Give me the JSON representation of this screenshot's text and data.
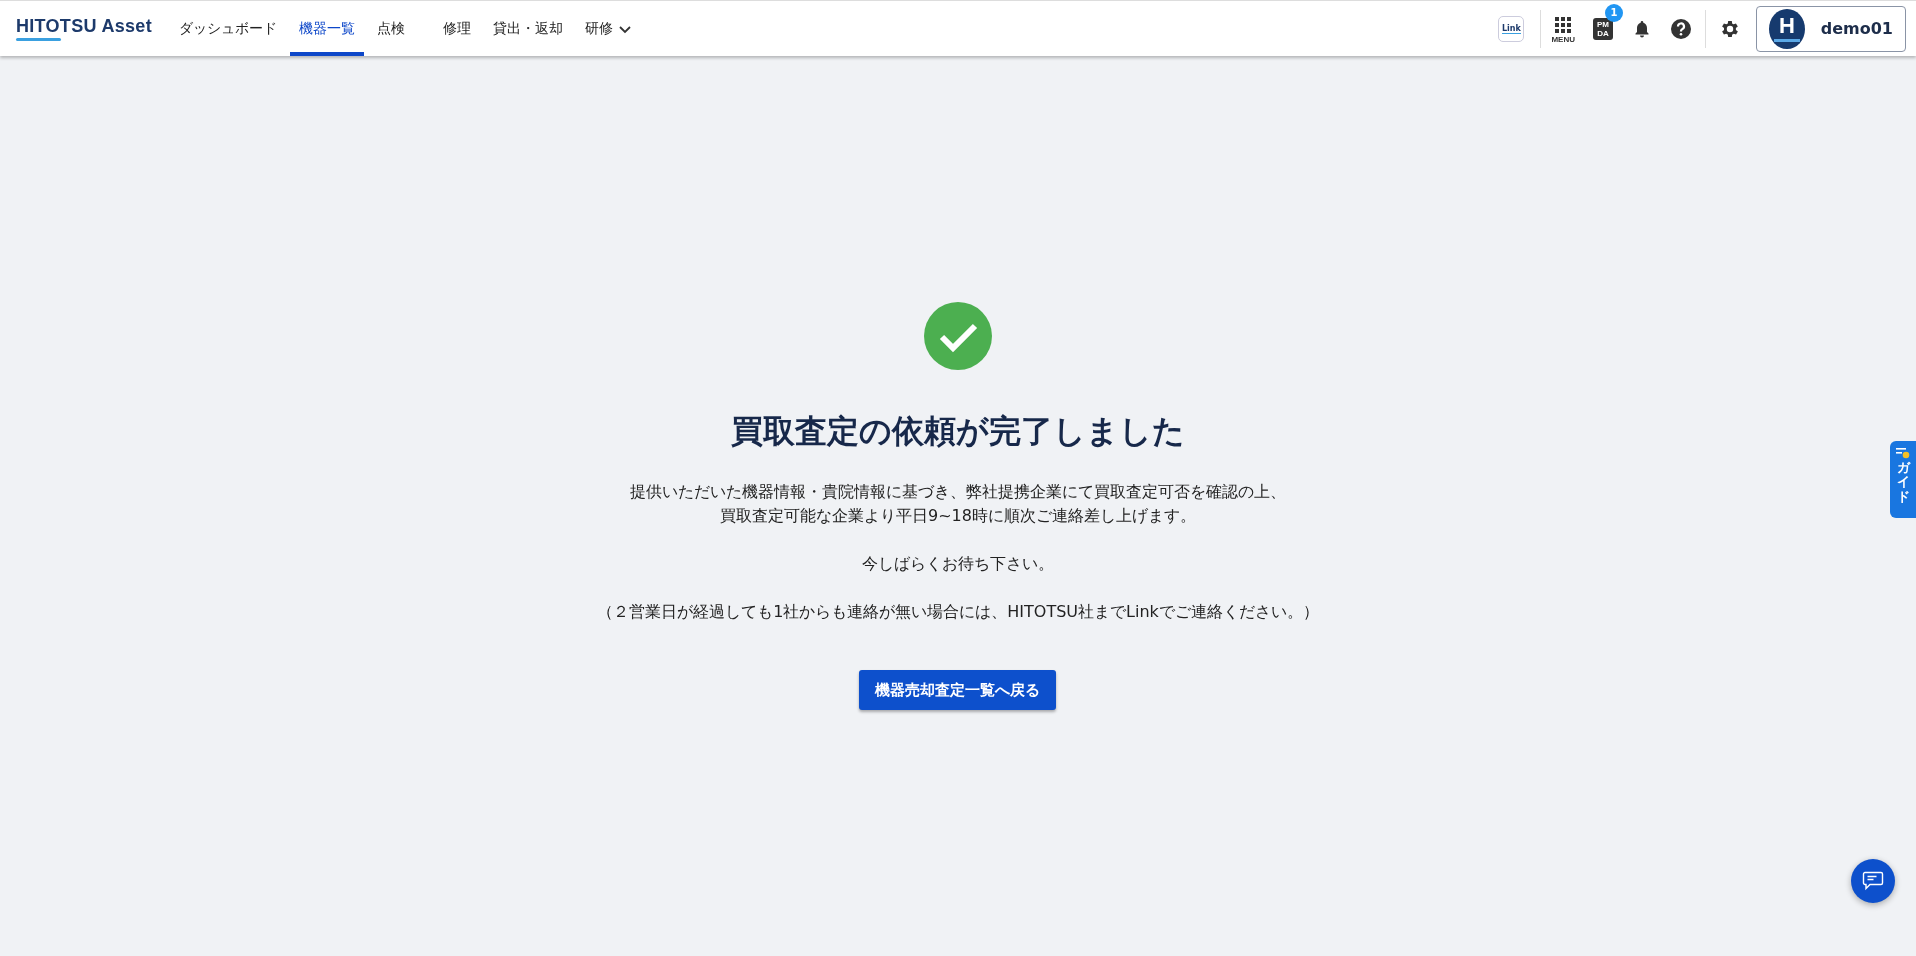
{
  "header": {
    "logo": "HITOTSU Asset",
    "nav": [
      {
        "label": "ダッシュボード",
        "selected": false,
        "has_menu": false
      },
      {
        "label": "機器一覧",
        "selected": true,
        "has_menu": false
      },
      {
        "label": "点検",
        "selected": false,
        "has_menu": false
      },
      {
        "label": "修理",
        "selected": false,
        "has_menu": false
      },
      {
        "label": "貸出・返却",
        "selected": false,
        "has_menu": false
      },
      {
        "label": "研修",
        "selected": false,
        "has_menu": true
      }
    ],
    "link_app": "Link",
    "menu_label": "MENU",
    "pmda": {
      "lines": [
        "PM",
        "DA"
      ],
      "badge": "1"
    },
    "user": {
      "initial": "H",
      "name": "demo01"
    }
  },
  "result": {
    "title": "買取査定の依頼が完了しました",
    "message_lines": [
      "提供いただいた機器情報・貴院情報に基づき、弊社提携企業にて買取査定可否を確認の上、",
      "買取査定可能な企業より平日9~18時に順次ご連絡差し上げます。"
    ],
    "wait_note": "今しばらくお待ち下さい。",
    "contact_note": "（２営業日が経過しても1社からも連絡が無い場合には、HITOTSU社までLinkでご連絡ください。）",
    "back_button": "機器売却査定一覧へ戻る"
  },
  "guide_tab": "ガイド"
}
